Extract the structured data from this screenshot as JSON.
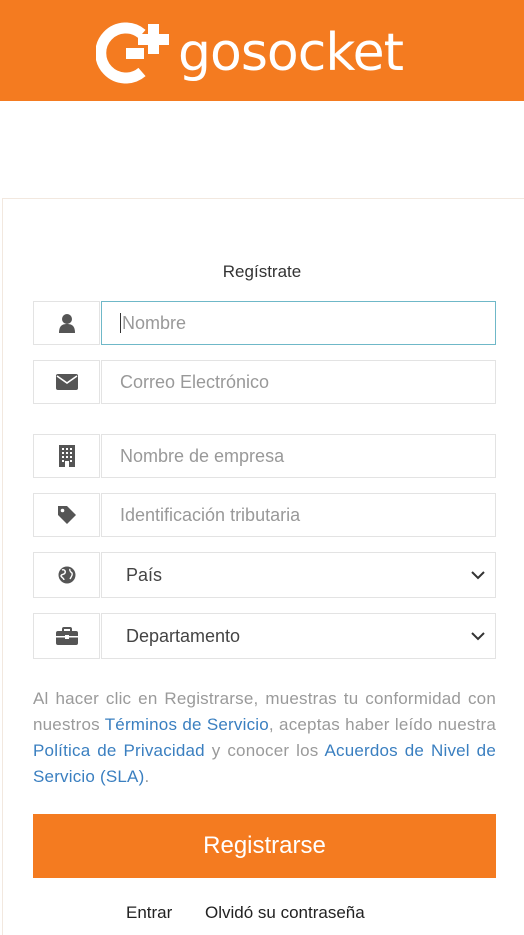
{
  "brand": {
    "name": "gosocket",
    "color": "#F47B20"
  },
  "form": {
    "title": "Regístrate",
    "fields": [
      {
        "icon": "user-icon",
        "placeholder": "Nombre"
      },
      {
        "icon": "envelope-icon",
        "placeholder": "Correo Electrónico"
      },
      {
        "icon": "building-icon",
        "placeholder": "Nombre de empresa"
      },
      {
        "icon": "tag-icon",
        "placeholder": "Identificación tributaria"
      }
    ],
    "selects": [
      {
        "icon": "globe-icon",
        "value": "País"
      },
      {
        "icon": "briefcase-icon",
        "value": "Departamento"
      }
    ],
    "terms": {
      "t1": "Al hacer clic en Registrarse, muestras tu conformidad con nuestros ",
      "l1": "Términos de Servicio",
      "t2": ", aceptas haber leído nuestra ",
      "l2": "Política de Privacidad",
      "t3": " y conocer los ",
      "l3": "Acuerdos de Nivel de Servicio (SLA)",
      "t4": "."
    },
    "submit_label": "Registrarse"
  },
  "footer": {
    "login_link": "Entrar",
    "forgot_link": "Olvidó su contraseña"
  },
  "colors": {
    "accent": "#F47B20",
    "link": "#3a7fc0",
    "focus_border": "#6fb8c8"
  }
}
